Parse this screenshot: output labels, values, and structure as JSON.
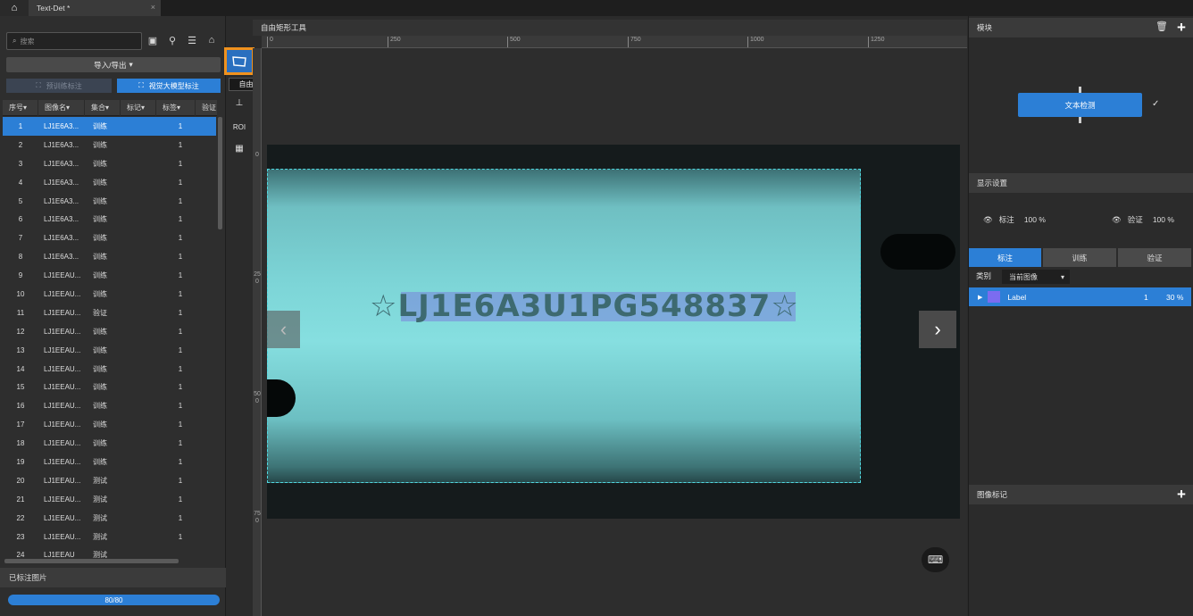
{
  "titlebar": {
    "home_icon": "home-icon",
    "tab_title": "Text-Det *",
    "tab_close": "×"
  },
  "left": {
    "search_placeholder": "搜索",
    "import_export": "导入/导出",
    "btn_pretrain": "预训练标注",
    "btn_vision": "视觉大模型标注",
    "columns": [
      "序号",
      "图像名",
      "集合",
      "标记",
      "标签",
      "验证"
    ],
    "rows": [
      {
        "id": "1",
        "name": "LJ1E6A3...",
        "set": "训练",
        "label": "1"
      },
      {
        "id": "2",
        "name": "LJ1E6A3...",
        "set": "训练",
        "label": "1"
      },
      {
        "id": "3",
        "name": "LJ1E6A3...",
        "set": "训练",
        "label": "1"
      },
      {
        "id": "4",
        "name": "LJ1E6A3...",
        "set": "训练",
        "label": "1"
      },
      {
        "id": "5",
        "name": "LJ1E6A3...",
        "set": "训练",
        "label": "1"
      },
      {
        "id": "6",
        "name": "LJ1E6A3...",
        "set": "训练",
        "label": "1"
      },
      {
        "id": "7",
        "name": "LJ1E6A3...",
        "set": "训练",
        "label": "1"
      },
      {
        "id": "8",
        "name": "LJ1E6A3...",
        "set": "训练",
        "label": "1"
      },
      {
        "id": "9",
        "name": "LJ1EEAU...",
        "set": "训练",
        "label": "1"
      },
      {
        "id": "10",
        "name": "LJ1EEAU...",
        "set": "训练",
        "label": "1"
      },
      {
        "id": "11",
        "name": "LJ1EEAU...",
        "set": "验证",
        "label": "1"
      },
      {
        "id": "12",
        "name": "LJ1EEAU...",
        "set": "训练",
        "label": "1"
      },
      {
        "id": "13",
        "name": "LJ1EEAU...",
        "set": "训练",
        "label": "1"
      },
      {
        "id": "14",
        "name": "LJ1EEAU...",
        "set": "训练",
        "label": "1"
      },
      {
        "id": "15",
        "name": "LJ1EEAU...",
        "set": "训练",
        "label": "1"
      },
      {
        "id": "16",
        "name": "LJ1EEAU...",
        "set": "训练",
        "label": "1"
      },
      {
        "id": "17",
        "name": "LJ1EEAU...",
        "set": "训练",
        "label": "1"
      },
      {
        "id": "18",
        "name": "LJ1EEAU...",
        "set": "训练",
        "label": "1"
      },
      {
        "id": "19",
        "name": "LJ1EEAU...",
        "set": "训练",
        "label": "1"
      },
      {
        "id": "20",
        "name": "LJ1EEAU...",
        "set": "测试",
        "label": "1"
      },
      {
        "id": "21",
        "name": "LJ1EEAU...",
        "set": "测试",
        "label": "1"
      },
      {
        "id": "22",
        "name": "LJ1EEAU...",
        "set": "测试",
        "label": "1"
      },
      {
        "id": "23",
        "name": "LJ1EEAU...",
        "set": "测试",
        "label": "1"
      },
      {
        "id": "24",
        "name": "LJ1EEAU",
        "set": "测试",
        "label": ""
      }
    ],
    "annotated_header": "已标注图片",
    "progress_text": "80/80",
    "progress_fraction": 1.0
  },
  "tools": {
    "tooltip": "自由矩形工具 (K)",
    "roi_label": "ROI"
  },
  "canvas": {
    "header": "自由矩形工具",
    "ruler_top": [
      "0",
      "250",
      "500",
      "750",
      "1000",
      "1250"
    ],
    "ruler_left": [
      "0",
      "250",
      "500",
      "750"
    ],
    "plate_text": "☆LJ1E6A3U1PG548837☆"
  },
  "right": {
    "module_header": "模块",
    "module_node": "文本检测",
    "display_header": "显示设置",
    "annot_label": "标注",
    "annot_pct": "100 %",
    "verify_label": "验证",
    "verify_pct": "100 %",
    "tabs": [
      "标注",
      "训练",
      "验证"
    ],
    "category_label": "类别",
    "category_value": "当前图像",
    "label_name": "Label",
    "label_count": "1",
    "label_pct": "30 %",
    "label_color": "#7b6cf0",
    "image_marks_header": "图像标记"
  },
  "colors": {
    "accent": "#2c7fd6",
    "highlight": "#f0921e"
  }
}
